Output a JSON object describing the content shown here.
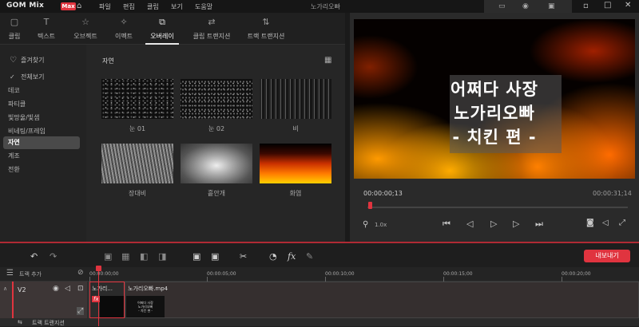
{
  "app": {
    "name": "GOM Mix",
    "badge": "Max",
    "window_title": "노가리오빠"
  },
  "menu": [
    "파일",
    "편집",
    "클립",
    "보기",
    "도움말"
  ],
  "tabs": [
    {
      "label": "클립",
      "icon": "clip-icon"
    },
    {
      "label": "텍스트",
      "icon": "text-icon"
    },
    {
      "label": "오브젝트",
      "icon": "object-icon"
    },
    {
      "label": "이펙트",
      "icon": "effect-icon"
    },
    {
      "label": "오버레이",
      "icon": "overlay-icon",
      "active": true
    },
    {
      "label": "클립 트랜지션",
      "icon": "clip-transition-icon"
    },
    {
      "label": "트랙 트랜지션",
      "icon": "track-transition-icon"
    }
  ],
  "sidebar": {
    "favorites": "즐겨찾기",
    "items": [
      "전체보기",
      "데코",
      "파티클",
      "빛망울/빛샘",
      "비네팅/프레임",
      "자연",
      "계조",
      "전환"
    ],
    "selected": "자연"
  },
  "content": {
    "section_title": "자연",
    "thumbs": [
      "눈 01",
      "눈 02",
      "비",
      "장대비",
      "흩안개",
      "화염"
    ]
  },
  "preview": {
    "overlay_lines": [
      "어쩌다 사장",
      "노가리오빠",
      "- 치킨 편 -"
    ],
    "current_time": "00:00:00;13",
    "total_time": "00:00:31;14",
    "zoom": "1.0x",
    "progress_fraction": 0.01
  },
  "timeline": {
    "export_label": "내보내기",
    "add_track_label": "트랙 추가",
    "ruler": [
      "00:00:00;00",
      "00:00:05;00",
      "00:00:10;00",
      "00:00:15;00",
      "00:00:20;00"
    ],
    "track_name": "V2",
    "clip1_label": "노가리...",
    "clip2_label": "노가리오빠.mp4",
    "clip_thumb_text": "어쩌다 사장\n노가리오빠\n- 치킨 편 -",
    "track2_label": "트랙 트랜지션"
  },
  "colors": {
    "accent": "#e0343f",
    "panel": "#252525",
    "selected": "#4a4a4a"
  }
}
